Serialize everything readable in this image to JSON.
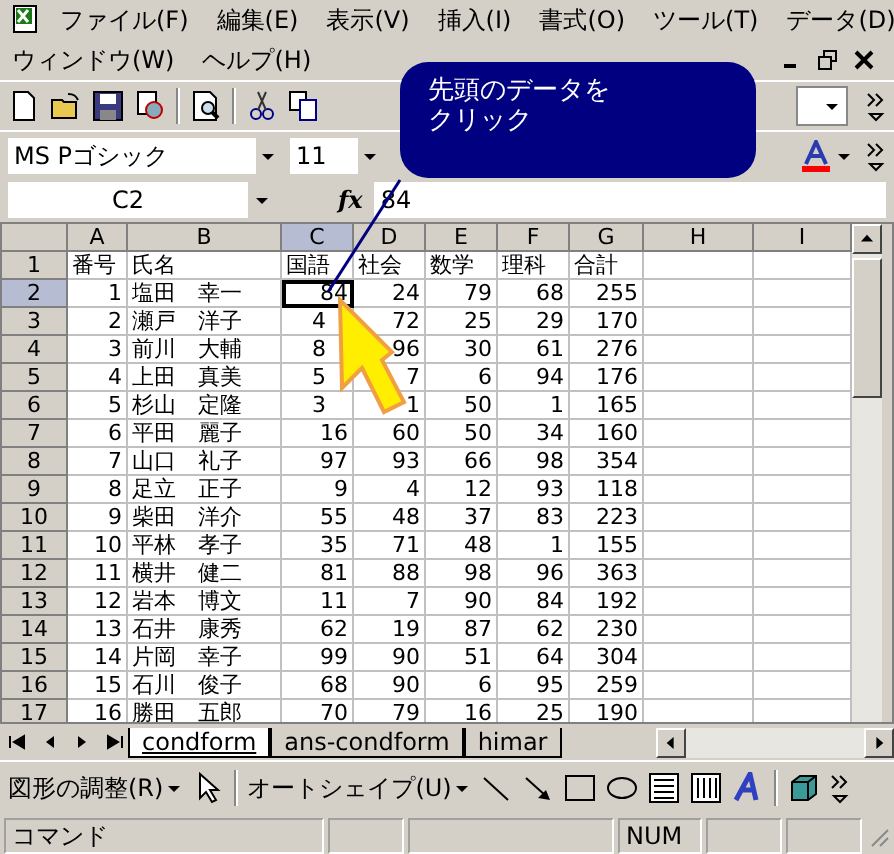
{
  "menu_rows": [
    [
      {
        "label": "ファイル(F)"
      },
      {
        "label": "編集(E)"
      },
      {
        "label": "表示(V)"
      },
      {
        "label": "挿入(I)"
      },
      {
        "label": "書式(O)"
      },
      {
        "label": "ツール(T)"
      },
      {
        "label": "データ(D)"
      }
    ],
    [
      {
        "label": "ウィンドウ(W)"
      },
      {
        "label": "ヘルプ(H)"
      }
    ]
  ],
  "font_name": "MS Pゴシック",
  "font_size": "11",
  "name_box": "C2",
  "fx_label": "fx",
  "formula": "84",
  "callout_lines": [
    "先頭のデータを",
    "クリック"
  ],
  "columns": [
    {
      "label": "A",
      "selected": false
    },
    {
      "label": "B",
      "selected": false
    },
    {
      "label": "C",
      "selected": true
    },
    {
      "label": "D",
      "selected": false
    },
    {
      "label": "E",
      "selected": false
    },
    {
      "label": "F",
      "selected": false
    },
    {
      "label": "G",
      "selected": false
    },
    {
      "label": "H",
      "selected": false
    },
    {
      "label": "I",
      "selected": false
    }
  ],
  "rows": [
    {
      "number": "1",
      "kind": "header",
      "selected": false,
      "cells": [
        "番号",
        "氏名",
        "国語",
        "社会",
        "数学",
        "理科",
        "合計"
      ]
    },
    {
      "number": "2",
      "kind": "data",
      "selected": true,
      "cells": [
        "1",
        "塩田　幸一",
        "84",
        "24",
        "79",
        "68",
        "255"
      ]
    },
    {
      "number": "3",
      "kind": "data",
      "selected": false,
      "covered": [
        false,
        false,
        true,
        false,
        false,
        false,
        false
      ],
      "cells": [
        "2",
        "瀬戸　洋子",
        "4",
        "72",
        "25",
        "29",
        "170"
      ]
    },
    {
      "number": "4",
      "kind": "data",
      "selected": false,
      "covered": [
        false,
        false,
        true,
        false,
        false,
        false,
        false
      ],
      "cells": [
        "3",
        "前川　大輔",
        "8",
        "96",
        "30",
        "61",
        "276"
      ]
    },
    {
      "number": "5",
      "kind": "data",
      "selected": false,
      "covered": [
        false,
        false,
        true,
        false,
        false,
        false,
        false
      ],
      "cells": [
        "4",
        "上田　真美",
        "5",
        "7",
        "6",
        "94",
        "176"
      ]
    },
    {
      "number": "6",
      "kind": "data",
      "selected": false,
      "covered": [
        false,
        false,
        true,
        false,
        false,
        false,
        false
      ],
      "cells": [
        "5",
        "杉山　定隆",
        "3",
        "1",
        "50",
        "1",
        "165"
      ]
    },
    {
      "number": "7",
      "kind": "data",
      "selected": false,
      "cells": [
        "6",
        "平田　麗子",
        "16",
        "60",
        "50",
        "34",
        "160"
      ]
    },
    {
      "number": "8",
      "kind": "data",
      "selected": false,
      "cells": [
        "7",
        "山口　礼子",
        "97",
        "93",
        "66",
        "98",
        "354"
      ]
    },
    {
      "number": "9",
      "kind": "data",
      "selected": false,
      "cells": [
        "8",
        "足立　正子",
        "9",
        "4",
        "12",
        "93",
        "118"
      ]
    },
    {
      "number": "10",
      "kind": "data",
      "selected": false,
      "cells": [
        "9",
        "柴田　洋介",
        "55",
        "48",
        "37",
        "83",
        "223"
      ]
    },
    {
      "number": "11",
      "kind": "data",
      "selected": false,
      "cells": [
        "10",
        "平林　孝子",
        "35",
        "71",
        "48",
        "1",
        "155"
      ]
    },
    {
      "number": "12",
      "kind": "data",
      "selected": false,
      "cells": [
        "11",
        "横井　健二",
        "81",
        "88",
        "98",
        "96",
        "363"
      ]
    },
    {
      "number": "13",
      "kind": "data",
      "selected": false,
      "cells": [
        "12",
        "岩本　博文",
        "11",
        "7",
        "90",
        "84",
        "192"
      ]
    },
    {
      "number": "14",
      "kind": "data",
      "selected": false,
      "cells": [
        "13",
        "石井　康秀",
        "62",
        "19",
        "87",
        "62",
        "230"
      ]
    },
    {
      "number": "15",
      "kind": "data",
      "selected": false,
      "cells": [
        "14",
        "片岡　幸子",
        "99",
        "90",
        "51",
        "64",
        "304"
      ]
    },
    {
      "number": "16",
      "kind": "data",
      "selected": false,
      "cells": [
        "15",
        "石川　俊子",
        "68",
        "90",
        "6",
        "95",
        "259"
      ]
    },
    {
      "number": "17",
      "kind": "data",
      "selected": false,
      "cells": [
        "16",
        "勝田　五郎",
        "70",
        "79",
        "16",
        "25",
        "190"
      ]
    }
  ],
  "sheet_tabs": [
    {
      "label": "condform",
      "selected": true
    },
    {
      "label": "ans-condform",
      "selected": false
    },
    {
      "label": "himar",
      "selected": false
    }
  ],
  "draw_menu": "図形の調整(R)",
  "autoshape_menu": "オートシェイプ(U)",
  "status_mode": "コマンド",
  "status_indicators": [
    "NUM"
  ]
}
